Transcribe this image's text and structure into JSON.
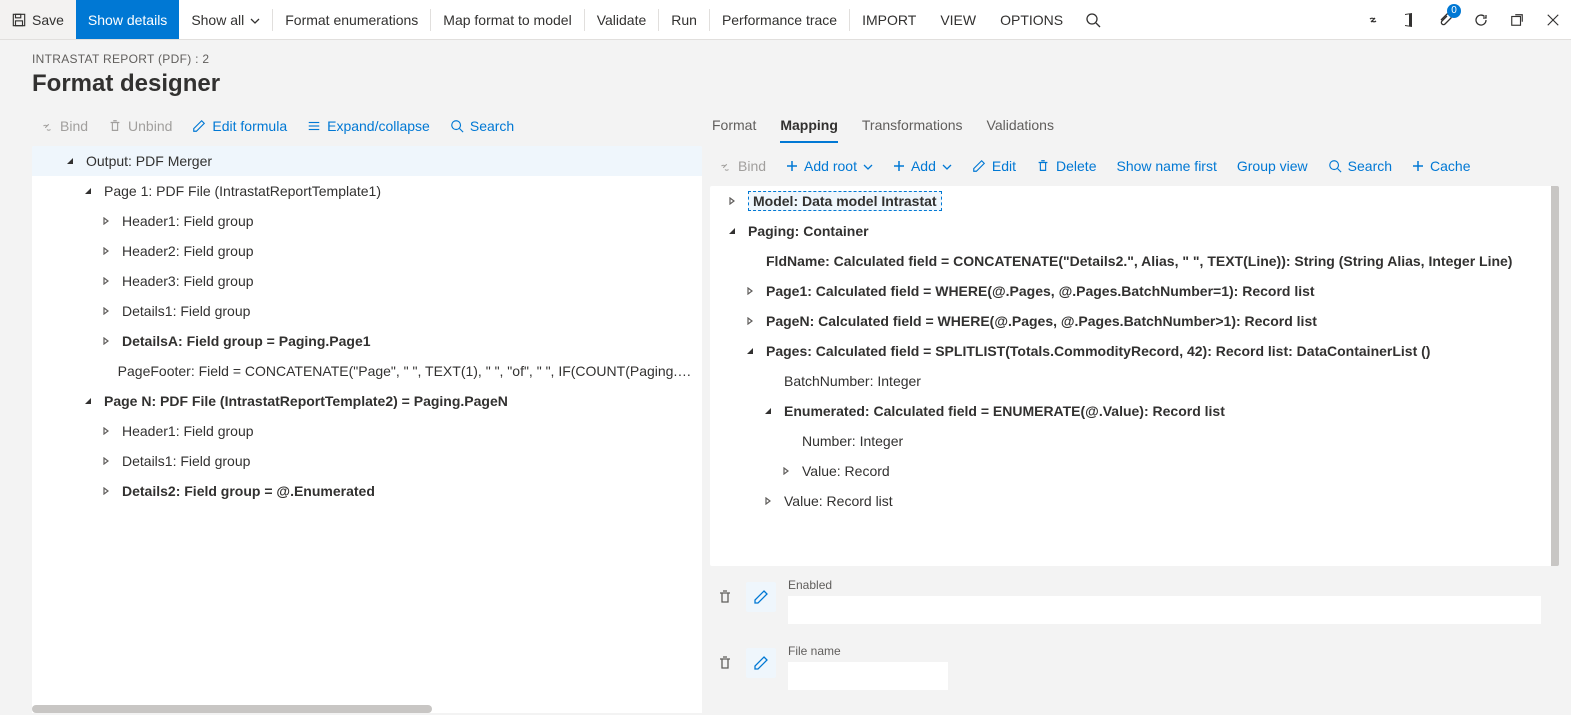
{
  "toolbar": {
    "save": "Save",
    "show_details": "Show details",
    "show_all": "Show all",
    "format_enum": "Format enumerations",
    "map_format": "Map format to model",
    "validate": "Validate",
    "run": "Run",
    "perf_trace": "Performance trace",
    "import": "IMPORT",
    "view": "VIEW",
    "options": "OPTIONS",
    "notif_count": "0"
  },
  "header": {
    "breadcrumb": "INTRASTAT REPORT (PDF) : 2",
    "title": "Format designer"
  },
  "left_toolbar": {
    "bind": "Bind",
    "unbind": "Unbind",
    "edit_formula": "Edit formula",
    "expand": "Expand/collapse",
    "search": "Search"
  },
  "left_tree": [
    {
      "ind": 0,
      "exp": "down",
      "bold": false,
      "sel": true,
      "text": "Output: PDF Merger"
    },
    {
      "ind": 1,
      "exp": "down",
      "bold": false,
      "sel": false,
      "text": "Page 1: PDF File (IntrastatReportTemplate1)"
    },
    {
      "ind": 2,
      "exp": "right",
      "bold": false,
      "sel": false,
      "text": "Header1: Field group"
    },
    {
      "ind": 2,
      "exp": "right",
      "bold": false,
      "sel": false,
      "text": "Header2: Field group"
    },
    {
      "ind": 2,
      "exp": "right",
      "bold": false,
      "sel": false,
      "text": "Header3: Field group"
    },
    {
      "ind": 2,
      "exp": "right",
      "bold": false,
      "sel": false,
      "text": "Details1: Field group"
    },
    {
      "ind": 2,
      "exp": "right",
      "bold": true,
      "sel": false,
      "text": "DetailsA: Field group = Paging.Page1"
    },
    {
      "ind": 2,
      "exp": "none",
      "bold": false,
      "sel": false,
      "text": "PageFooter: Field = CONCATENATE(\"Page\", \" \", TEXT(1), \" \", \"of\", \" \", IF(COUNT(Paging.Pages)>",
      "more": true
    },
    {
      "ind": 1,
      "exp": "down",
      "bold": true,
      "sel": false,
      "text": "Page N: PDF File (IntrastatReportTemplate2) = Paging.PageN"
    },
    {
      "ind": 2,
      "exp": "right",
      "bold": false,
      "sel": false,
      "text": "Header1: Field group"
    },
    {
      "ind": 2,
      "exp": "right",
      "bold": false,
      "sel": false,
      "text": "Details1: Field group"
    },
    {
      "ind": 2,
      "exp": "right",
      "bold": true,
      "sel": false,
      "text": "Details2: Field group = @.Enumerated"
    }
  ],
  "right_tabs": {
    "format": "Format",
    "mapping": "Mapping",
    "transformations": "Transformations",
    "validations": "Validations",
    "active": "mapping"
  },
  "right_toolbar": {
    "bind": "Bind",
    "add_root": "Add root",
    "add": "Add",
    "edit": "Edit",
    "delete": "Delete",
    "show_name": "Show name first",
    "group_view": "Group view",
    "search": "Search",
    "cache": "Cache"
  },
  "right_tree": [
    {
      "ind": 0,
      "exp": "right",
      "bold": true,
      "box": true,
      "text": "Model: Data model Intrastat"
    },
    {
      "ind": 0,
      "exp": "down",
      "bold": true,
      "text": "Paging: Container"
    },
    {
      "ind": 1,
      "exp": "none",
      "bold": true,
      "text": "FldName: Calculated field = CONCATENATE(\"Details2.\", Alias, \" \", TEXT(Line)): String (String Alias, Integer Line)"
    },
    {
      "ind": 1,
      "exp": "right",
      "bold": true,
      "text": "Page1: Calculated field = WHERE(@.Pages, @.Pages.BatchNumber=1): Record list"
    },
    {
      "ind": 1,
      "exp": "right",
      "bold": true,
      "text": "PageN: Calculated field = WHERE(@.Pages, @.Pages.BatchNumber>1): Record list"
    },
    {
      "ind": 1,
      "exp": "down",
      "bold": true,
      "text": "Pages: Calculated field = SPLITLIST(Totals.CommodityRecord, 42): Record list: DataContainerList ()"
    },
    {
      "ind": 2,
      "exp": "none",
      "bold": false,
      "text": "BatchNumber: Integer"
    },
    {
      "ind": 2,
      "exp": "down",
      "bold": true,
      "text": "Enumerated: Calculated field = ENUMERATE(@.Value): Record list"
    },
    {
      "ind": 3,
      "exp": "none",
      "bold": false,
      "text": "Number: Integer"
    },
    {
      "ind": 3,
      "exp": "right",
      "bold": false,
      "text": "Value: Record"
    },
    {
      "ind": 2,
      "exp": "right",
      "bold": false,
      "text": "Value: Record list"
    }
  ],
  "fields": {
    "enabled_label": "Enabled",
    "enabled_value": "",
    "filename_label": "File name",
    "filename_value": ""
  }
}
